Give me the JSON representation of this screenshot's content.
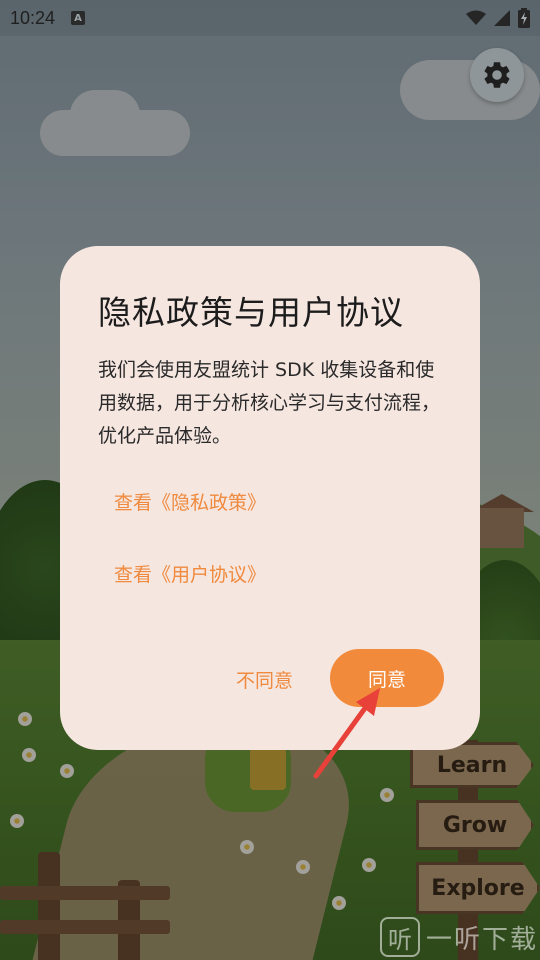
{
  "status_bar": {
    "time": "10:24",
    "notification_icon": "a-icon",
    "wifi_icon": "wifi-icon",
    "signal_icon": "signal-icon",
    "battery_icon": "battery-charging-icon"
  },
  "settings": {
    "icon": "gear-icon"
  },
  "dialog": {
    "title": "隐私政策与用户协议",
    "body": "我们会使用友盟统计 SDK 收集设备和使用数据，用于分析核心学习与支付流程，优化产品体验。",
    "link_privacy": "查看《隐私政策》",
    "link_terms": "查看《用户协议》",
    "disagree_label": "不同意",
    "agree_label": "同意"
  },
  "background": {
    "signs": [
      "Learn",
      "Grow",
      "Explore"
    ]
  },
  "watermark": {
    "logo": "听",
    "text": "一听下载"
  },
  "colors": {
    "accent": "#f28a3b",
    "dialog_bg": "#f6e6e0",
    "arrow": "#e8413a"
  }
}
